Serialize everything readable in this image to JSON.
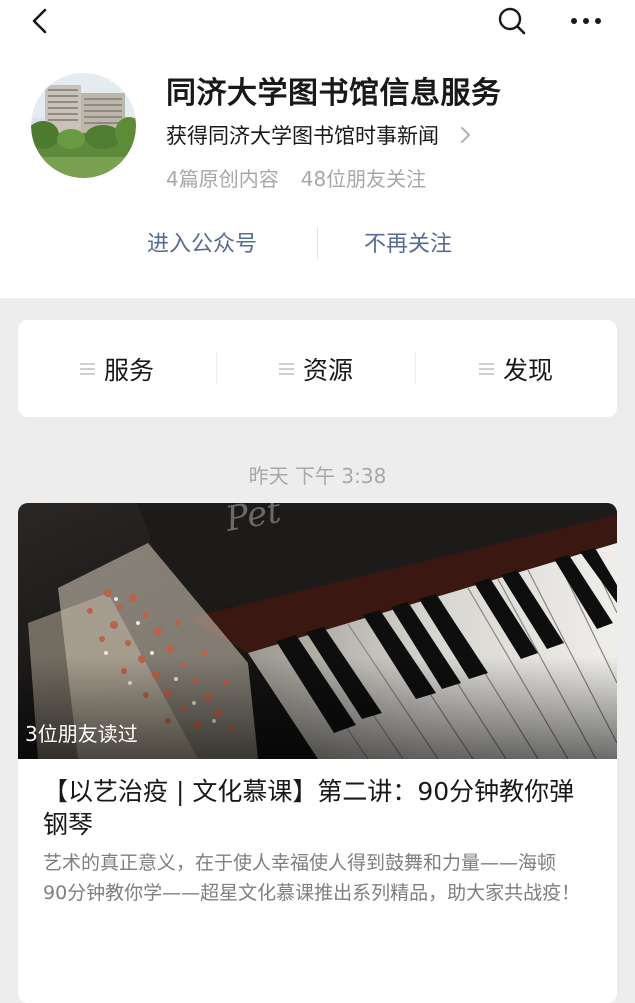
{
  "profile": {
    "name": "同济大学图书馆信息服务",
    "description": "获得同济大学图书馆时事新闻",
    "original_count": "4篇原创内容",
    "followers": "48位朋友关注"
  },
  "actions": {
    "enter": "进入公众号",
    "unfollow": "不再关注"
  },
  "menu": {
    "items": [
      {
        "label": "服务",
        "icon": "menu-lines-icon"
      },
      {
        "label": "资源",
        "icon": "menu-lines-icon"
      },
      {
        "label": "发现",
        "icon": "menu-lines-icon"
      }
    ]
  },
  "feed": {
    "timestamp": "昨天 下午 3:38",
    "article": {
      "friends_read": "3位朋友读过",
      "title": "【以艺治疫 | 文化慕课】第二讲：90分钟教你弹钢琴",
      "summary_line1": "艺术的真正意义，在于使人幸福使人得到鼓舞和力量——海顿",
      "summary_line2": "90分钟教你学——超星文化慕课推出系列精品，助大家共战疫！"
    }
  },
  "colors": {
    "link": "#576b95",
    "muted": "#a8a8a8",
    "background": "#ededed",
    "card": "#ffffff"
  },
  "icons": [
    "back-icon",
    "search-icon",
    "more-icon",
    "chevron-right-icon",
    "menu-lines-icon"
  ]
}
